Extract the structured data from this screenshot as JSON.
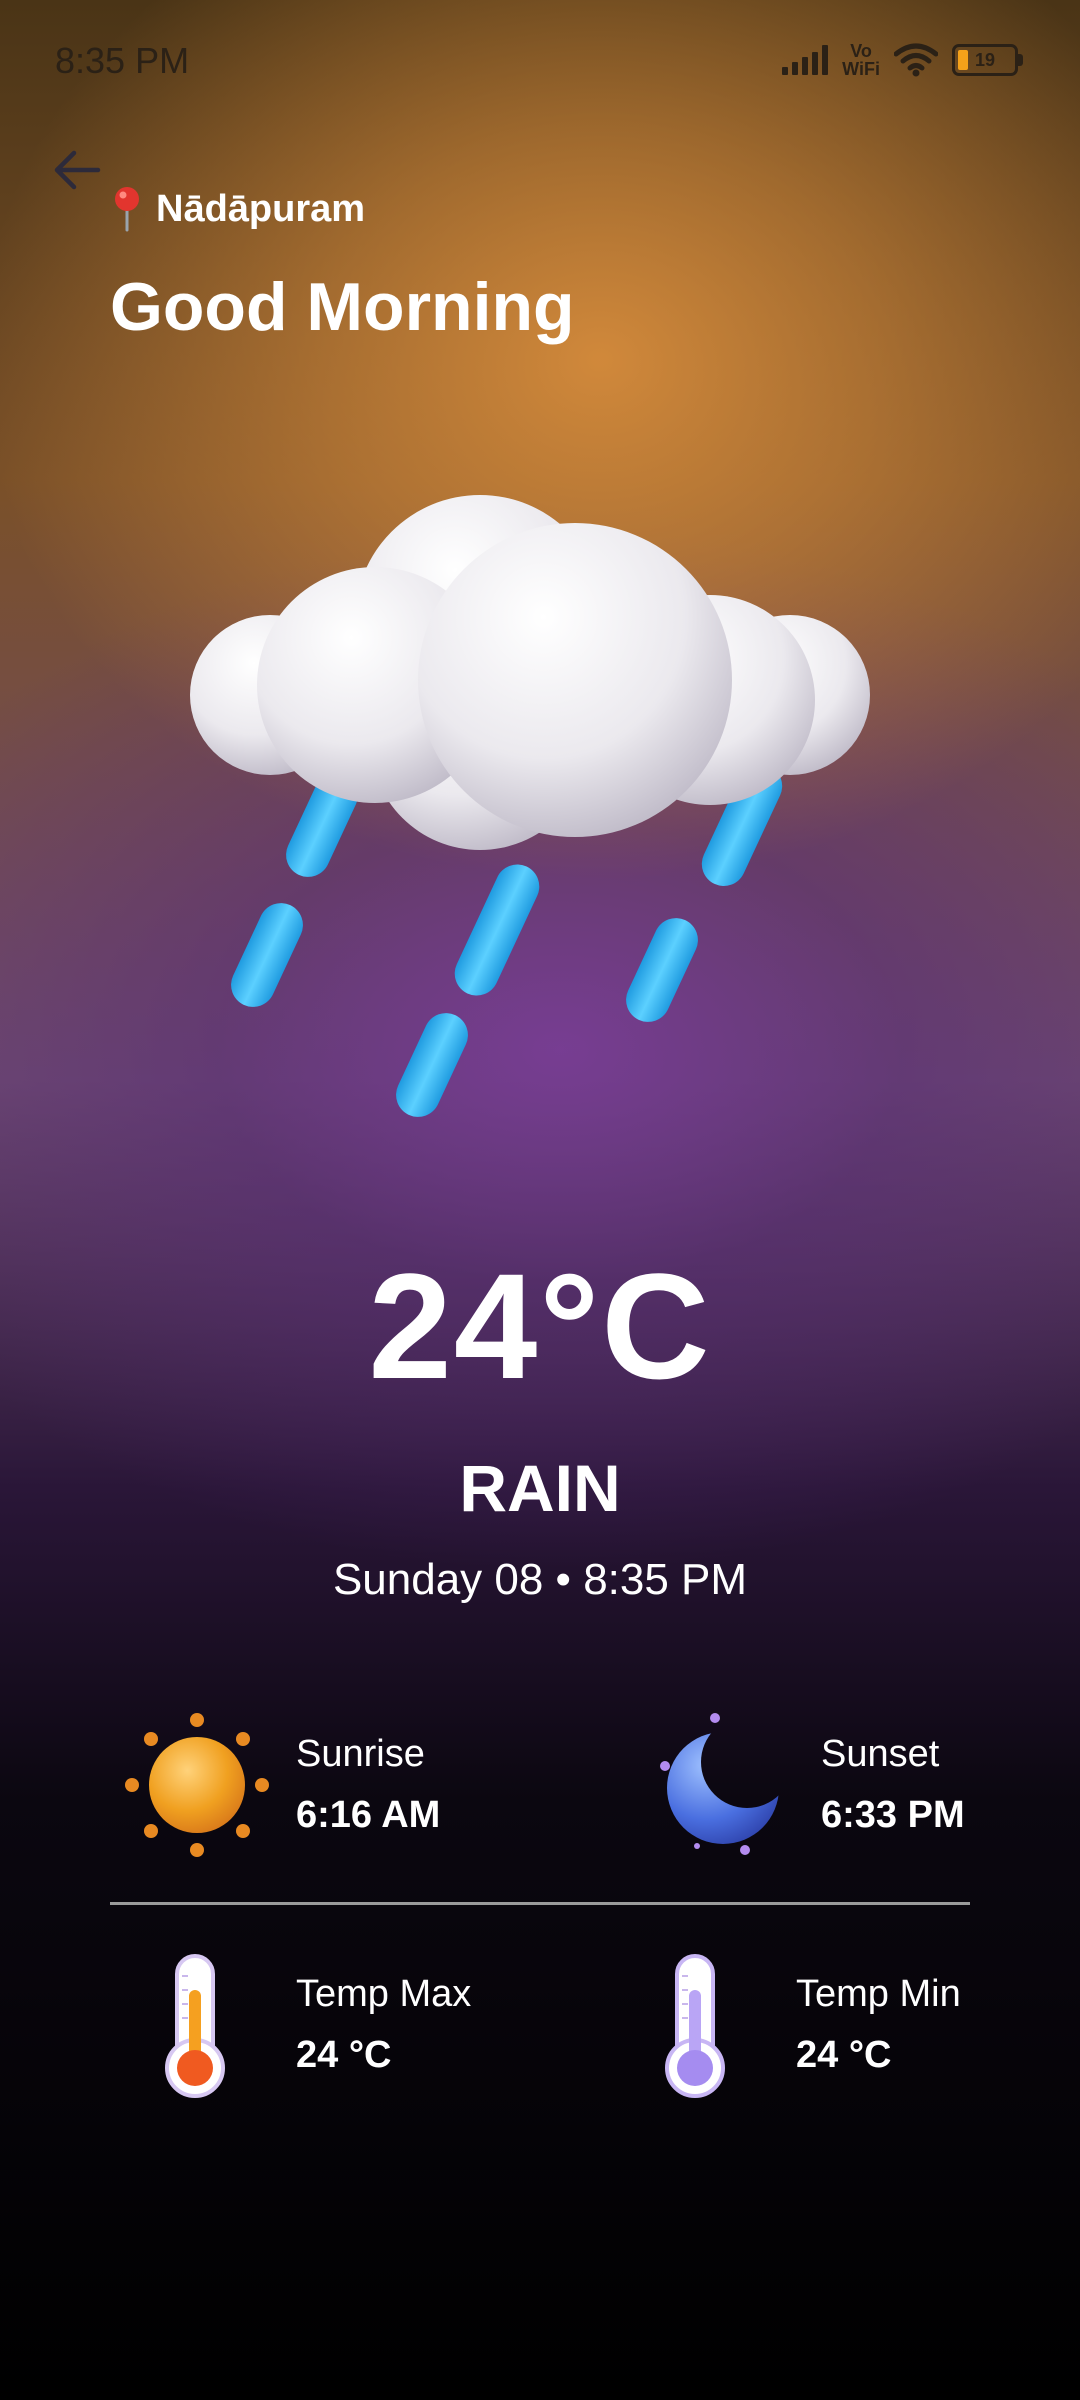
{
  "status_bar": {
    "time": "8:35 PM",
    "network_label_top": "Vo",
    "network_label_bottom": "WiFi",
    "battery_level": "19"
  },
  "header": {
    "location": "Nādāpuram",
    "greeting": "Good Morning"
  },
  "weather": {
    "icon": "rain-cloud-icon",
    "temperature": "24°C",
    "condition": "RAIN",
    "datetime": "Sunday 08 • 8:35 PM"
  },
  "details": {
    "sunrise": {
      "label": "Sunrise",
      "value": "6:16 AM",
      "icon": "sun-icon"
    },
    "sunset": {
      "label": "Sunset",
      "value": "6:33 PM",
      "icon": "moon-icon"
    },
    "temp_max": {
      "label": "Temp Max",
      "value": "24 °C",
      "icon": "thermometer-hot-icon"
    },
    "temp_min": {
      "label": "Temp Min",
      "value": "24 °C",
      "icon": "thermometer-cold-icon"
    }
  },
  "colors": {
    "rain_drop": "#39b6f0",
    "sun": "#f0a020",
    "moon": "#4a6fe0",
    "thermo_hot": "#f05a20",
    "thermo_cold": "#a58cf0"
  }
}
